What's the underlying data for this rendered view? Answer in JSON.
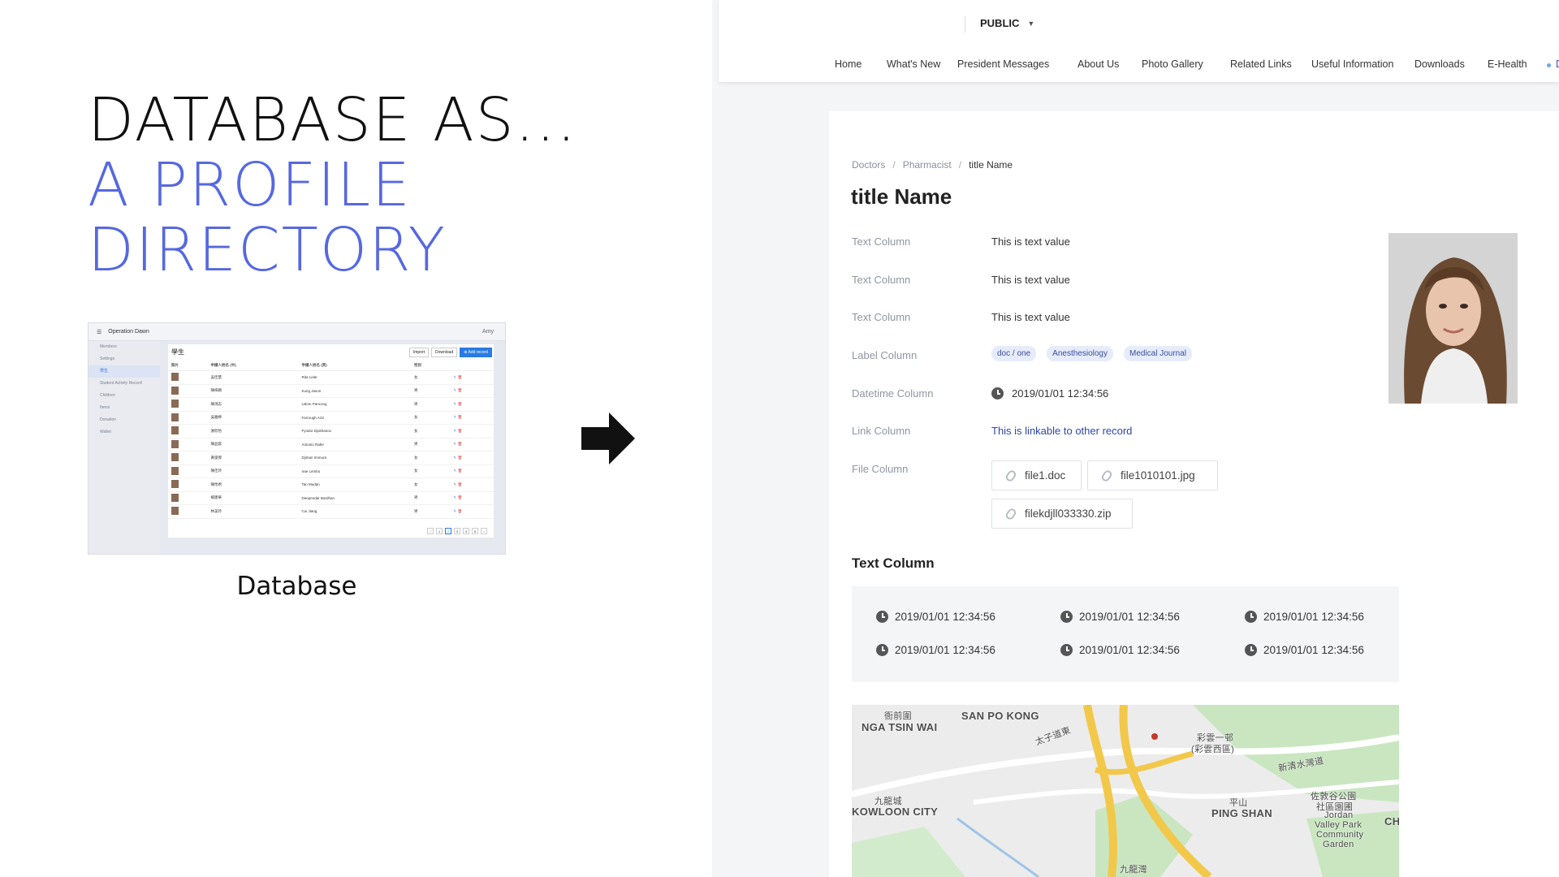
{
  "slide": {
    "heading_line1": "DATABASE AS...",
    "heading_line2": "A PROFILE",
    "heading_line3": "DIRECTORY",
    "caption": "Database"
  },
  "db_thumb": {
    "app_title": "Operation Dawn",
    "user": "Amy",
    "page_title": "學生",
    "buttons": [
      "Import",
      "Download",
      "⊕ Add record"
    ],
    "sidebar": [
      "Members",
      "Settings",
      "學生",
      "Student Activity Record",
      "Children",
      "Items",
      "Donation",
      "Wallet"
    ],
    "columns": [
      "照片",
      "申請人姓名 (中)",
      "申請人姓名 (英)",
      "性別"
    ],
    "rows": [
      [
        "吳佳慧",
        "Rita Leite",
        "女"
      ],
      [
        "陳梓穎",
        "Kung Jason",
        "男"
      ],
      [
        "陳鴻志",
        "Udom Pancong",
        "男"
      ],
      [
        "吳雅婷",
        "Farrough Aziz",
        "女"
      ],
      [
        "謝欣怡",
        "Fyodor Djukhanov",
        "女"
      ],
      [
        "陳品鋐",
        "Antonio Rafer",
        "男"
      ],
      [
        "黃俊傑",
        "Djiman Immura",
        "女"
      ],
      [
        "陳佳玲",
        "Irae Lembu",
        "女"
      ],
      [
        "陳怡君",
        "Tan Mudan",
        "女"
      ],
      [
        "楊建華",
        "Deependar Bardhan",
        "男"
      ],
      [
        "林美玲",
        "Cui Jiang",
        "男"
      ]
    ]
  },
  "shot": {
    "scope": "PUBLIC",
    "nav": [
      "Home",
      "What's New",
      "President Messages",
      "About Us",
      "Photo Gallery",
      "Related Links",
      "Useful Information",
      "Downloads",
      "E-Health",
      "D"
    ],
    "breadcrumb": [
      "Doctors",
      "Pharmacist",
      "title Name"
    ],
    "title": "title Name",
    "fields": [
      {
        "key": "Text Column",
        "value": "This is text value"
      },
      {
        "key": "Text Column",
        "value": "This is text value"
      },
      {
        "key": "Text Column",
        "value": "This is text value"
      },
      {
        "key": "Label Column",
        "tags": [
          "doc / one",
          "Anesthesiology",
          "Medical Journal"
        ]
      },
      {
        "key": "Datetime Column",
        "value": "2019/01/01 12:34:56"
      },
      {
        "key": "Link Column",
        "value": "This is linkable to other record"
      },
      {
        "key": "File Column",
        "files": [
          "file1.doc",
          "file1010101.jpg",
          "filekdjll033330.zip"
        ]
      }
    ],
    "section_title": "Text Column",
    "timestamps": [
      "2019/01/01 12:34:56",
      "2019/01/01 12:34:56",
      "2019/01/01 12:34:56",
      "2019/01/01 12:34:56",
      "2019/01/01 12:34:56",
      "2019/01/01 12:34:56"
    ],
    "map_labels": [
      "衙前圍",
      "NGA TSIN WAI",
      "SAN PO KONG",
      "彩雲一邨",
      "(彩雲西區)",
      "九龍城",
      "KOWLOON CITY",
      "平山",
      "PING SHAN",
      "佐敦谷公園",
      "社區園圃",
      "Jordan",
      "Valley Park",
      "Community",
      "Garden",
      "九龍灣",
      "太子道東",
      "新清水灣道",
      "CH"
    ]
  },
  "colors": {
    "accent_blue": "#5668e0",
    "link": "#2f47a6",
    "tag_bg": "#e6ecfb"
  }
}
